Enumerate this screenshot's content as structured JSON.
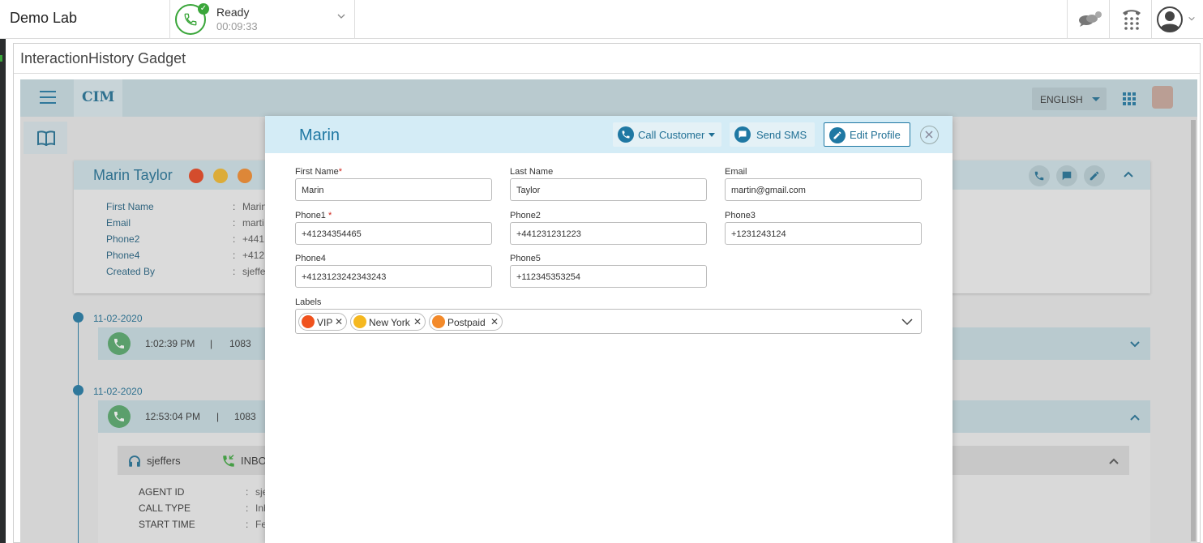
{
  "topbar": {
    "brand": "Demo Lab",
    "status": {
      "label": "Ready",
      "timer": "00:09:33"
    }
  },
  "gadget": {
    "title": "InteractionHistory Gadget"
  },
  "app": {
    "logo": "CIM",
    "language": "ENGLISH",
    "profile": {
      "name": "Marin Taylor",
      "label_colors": [
        "#e8431d",
        "#f2b72a",
        "#f38a2a"
      ],
      "fields": [
        {
          "label": "First Name",
          "value": "Marin"
        },
        {
          "label": "Email",
          "value": "marti"
        },
        {
          "label": "Phone2",
          "value": "+441"
        },
        {
          "label": "Phone4",
          "value": "+412"
        },
        {
          "label": "Created By",
          "value": "sjeffe"
        }
      ]
    },
    "timeline": [
      {
        "date": "11-02-2020",
        "time": "1:02:39 PM",
        "sep": "|",
        "number": "1083"
      },
      {
        "date": "11-02-2020",
        "time": "12:53:04 PM",
        "sep": "|",
        "number": "1083"
      }
    ],
    "agent": {
      "name": "sjeffers",
      "direction": "INBO",
      "details": [
        {
          "label": "AGENT ID",
          "value": "sje"
        },
        {
          "label": "CALL TYPE",
          "value": "Inb"
        },
        {
          "label": "START TIME",
          "value": "Fe"
        }
      ]
    }
  },
  "modal": {
    "title": "Marin",
    "buttons": {
      "call": "Call Customer",
      "sms": "Send SMS",
      "edit": "Edit Profile"
    },
    "fields": {
      "first_name": {
        "label": "First Name",
        "value": "Marin"
      },
      "last_name": {
        "label": "Last Name",
        "value": "Taylor"
      },
      "email": {
        "label": "Email",
        "value": "martin@gmail.com"
      },
      "phone1": {
        "label": "Phone1",
        "value": "+41234354465"
      },
      "phone2": {
        "label": "Phone2",
        "value": "+441231231223"
      },
      "phone3": {
        "label": "Phone3",
        "value": "+1231243124"
      },
      "phone4": {
        "label": "Phone4",
        "value": "+4123123242343243"
      },
      "phone5": {
        "label": "Phone5",
        "value": "+112345353254"
      }
    },
    "required_mark": "*",
    "labels_title": "Labels",
    "labels": [
      {
        "name": "VIP",
        "color": "#f0521d"
      },
      {
        "name": "New York",
        "color": "#f5b820"
      },
      {
        "name": "Postpaid",
        "color": "#f38a2a"
      }
    ]
  }
}
